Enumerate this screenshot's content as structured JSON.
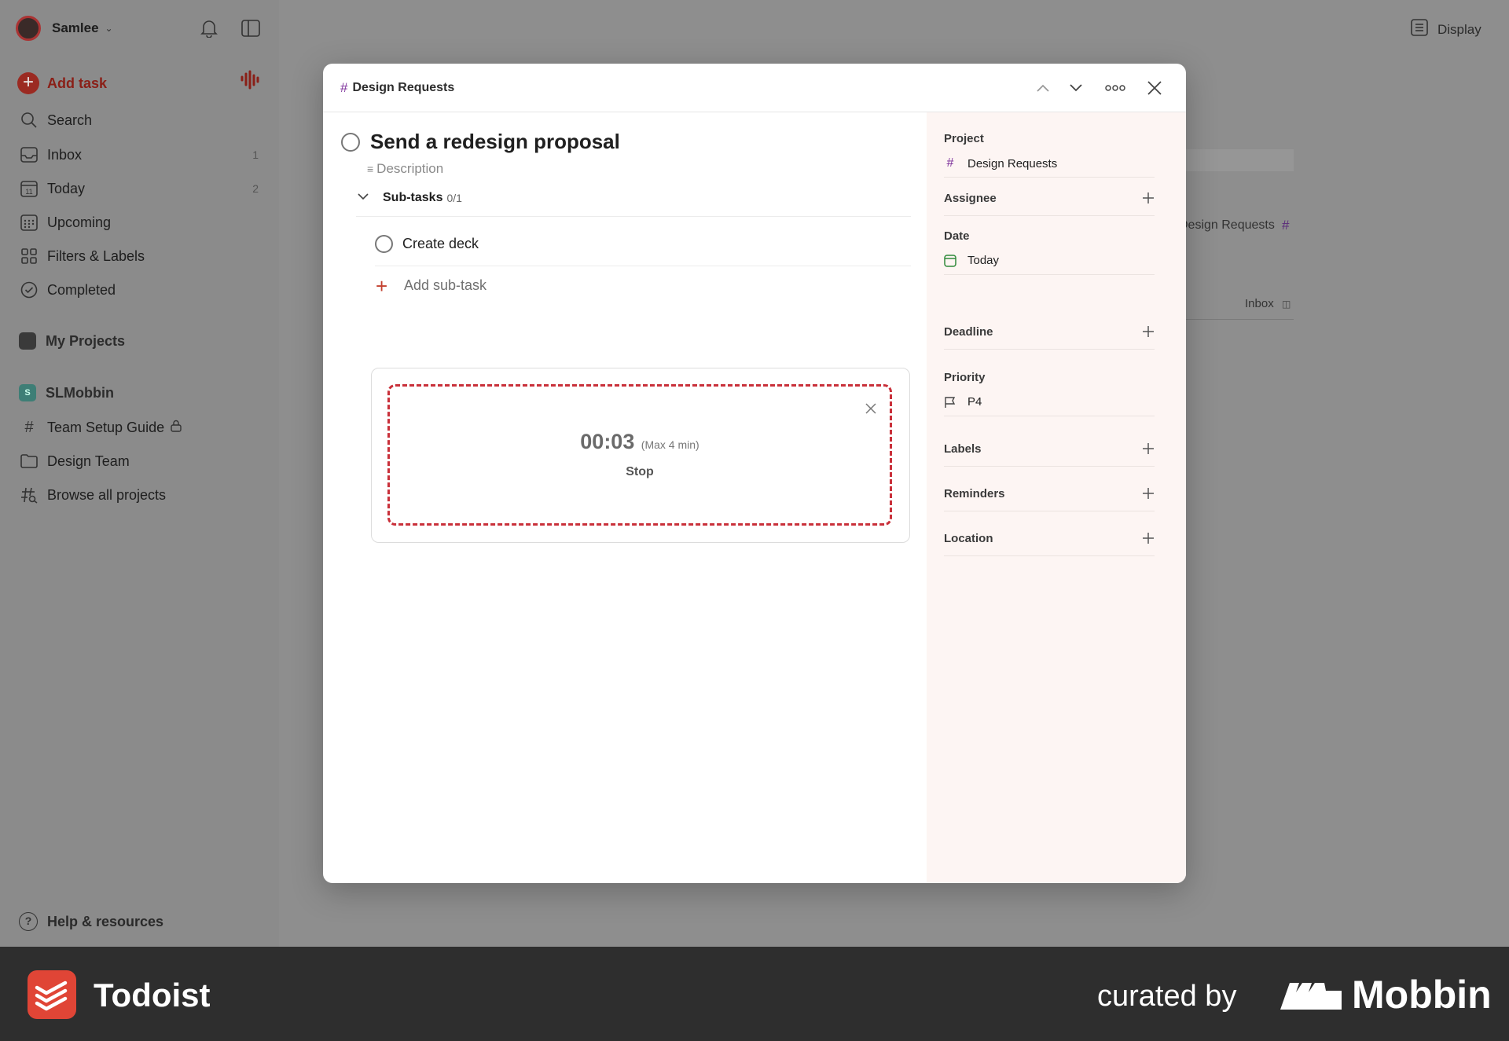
{
  "sidebar": {
    "user_name": "Samlee",
    "add_task_label": "Add task",
    "nav": [
      {
        "label": "Search",
        "count": ""
      },
      {
        "label": "Inbox",
        "count": "1"
      },
      {
        "label": "Today",
        "count": "2"
      },
      {
        "label": "Upcoming",
        "count": ""
      },
      {
        "label": "Filters & Labels",
        "count": ""
      },
      {
        "label": "Completed",
        "count": ""
      }
    ],
    "my_projects_label": "My Projects",
    "workspace_label": "SLMobbin",
    "workspace_initial": "S",
    "workspace_items": [
      {
        "label": "Team Setup Guide"
      },
      {
        "label": "Design Team"
      },
      {
        "label": "Browse all projects"
      }
    ],
    "help_label": "Help & resources"
  },
  "topbar": {
    "display_label": "Display"
  },
  "background_list": {
    "project_text": "Design Requests",
    "inbox_text": "Inbox"
  },
  "modal": {
    "breadcrumb": "Design Requests",
    "task_title": "Send a redesign proposal",
    "description_placeholder": "Description",
    "subtasks_label": "Sub-tasks",
    "subtasks_count": "0/1",
    "subtasks": [
      {
        "label": "Create deck"
      }
    ],
    "add_subtask_label": "Add sub-task",
    "recorder": {
      "time": "00:03",
      "max_label": "(Max 4 min)",
      "stop_label": "Stop"
    },
    "side": {
      "project_label": "Project",
      "project_value": "Design Requests",
      "assignee_label": "Assignee",
      "date_label": "Date",
      "date_value": "Today",
      "deadline_label": "Deadline",
      "priority_label": "Priority",
      "priority_value": "P4",
      "labels_label": "Labels",
      "reminders_label": "Reminders",
      "location_label": "Location"
    }
  },
  "footer": {
    "app_name": "Todoist",
    "curated_by": "curated by",
    "brand": "Mobbin"
  },
  "colors": {
    "accent_red": "#dc4c3e",
    "project_purple": "#7c2f9a",
    "recorder_dashed": "#c9303a",
    "side_panel_bg": "#fdf5f3"
  }
}
